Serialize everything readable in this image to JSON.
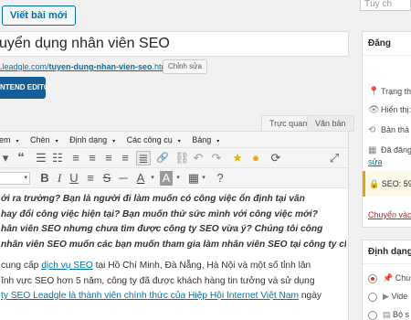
{
  "header": {
    "add_new_label": "Viết bài mới",
    "screen_options": "Tùy ch"
  },
  "post": {
    "title": "uyển dụng nhân viên SEO",
    "permalink_prefix": ".leadgle.com/",
    "permalink_slug": "tuyen-dung-nhan-vien-seo",
    "permalink_suffix": ".html",
    "edit_slug_label": "Chỉnh sửa",
    "frontend_editor_label": "NTEND EDITOR"
  },
  "editor": {
    "tabs": {
      "visual": "Trực quan",
      "text": "Văn bản"
    },
    "menu": [
      "em",
      "Chèn",
      "Định dạng",
      "Các công cụ",
      "Bảng"
    ],
    "font_size": "",
    "lead_paragraph": "ới ra trường? Bạn là người đi làm muốn có công việc ổn định tại văn hay đổi công việc hiện tại? Bạn muốn thử sức mình với công việc mới? hân viên SEO nhưng chưa tìm được công ty SEO vừa ý? Chúng tôi công nhân viên SEO muốn các bạn muốn tham gia làm nhân viên SEO tại công ty chúng tôi.",
    "lead_lines": [
      "ới ra trường? Bạn là người đi làm muốn có công việc ổn định tại văn",
      "hay đổi công việc hiện tại? Bạn muốn thử sức mình với công việc mới?",
      "hân viên SEO nhưng chưa tìm được công ty SEO vừa ý? Chúng tôi công",
      "nhân viên SEO muốn các bạn muốn tham gia làm nhân viên SEO tại công ty chúng tôi."
    ],
    "body_line1_pre": "cung cấp ",
    "body_line1_link": "dịch vụ SEO",
    "body_line1_post": " tại Hồ Chí Minh, Đà Nẵng, Hà Nội và một số tỉnh lân",
    "body_line2": "ĩnh vực SEO hơn 5 năm, công ty đã được khách hàng tin tưởng và sử dụng",
    "body_line3_link1": "ty SEO Leadgle là thành viên chính thức của ",
    "body_line3_link2": "Hiệp Hội Internet Việt Nam",
    "body_line3_post": " ngày"
  },
  "sidebar": {
    "publish": {
      "title": "Đăng",
      "status": "Trạng th",
      "visibility": "Hiển thị:",
      "revisions": "Bản thả",
      "published_on": "Đã đăng",
      "edit_link": "sửa",
      "seo": "SEO: 59",
      "trash": "Chuyển vào T"
    },
    "format": {
      "title": "Định dạng",
      "options": [
        "Chu",
        "Vide",
        "Bộ s"
      ]
    }
  },
  "colors": {
    "link": "#0073aa",
    "primary_button": "#135e96",
    "notice": "#dba617",
    "trash": "#b32d2e"
  }
}
